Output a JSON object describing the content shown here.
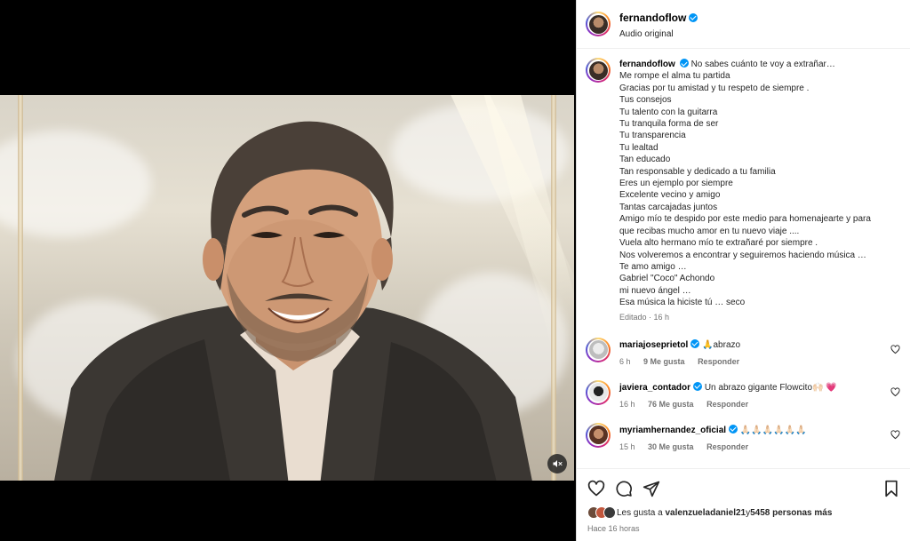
{
  "post": {
    "author": "fernandoflow",
    "audio_label": "Audio original"
  },
  "caption": {
    "author": "fernandoflow",
    "lines": [
      "No sabes cuánto te voy a extrañar…",
      "Me rompe el alma tu partida",
      "Gracias por tu amistad y tu respeto de siempre .",
      "Tus consejos",
      "Tu talento con la guitarra",
      "Tu tranquila forma de ser",
      "Tu transparencia",
      "Tu lealtad",
      "Tan educado",
      "Tan responsable y dedicado a tu familia",
      "Eres un ejemplo por siempre",
      "Excelente vecino y amigo",
      "Tantas carcajadas juntos",
      "Amigo mío te despido por este medio para homenajearte y para",
      "que recibas mucho amor en tu nuevo viaje ....",
      "Vuela alto hermano mío te extrañaré por siempre .",
      "Nos volveremos a encontrar y seguiremos haciendo música …",
      "Te amo amigo …",
      "Gabriel \"Coco\" Achondo",
      "mi nuevo ángel …",
      "Esa música la hiciste tú … seco"
    ],
    "edited": "Editado · 16 h"
  },
  "comments": [
    {
      "user": "mariajoseprietol",
      "text": "🙏abrazo",
      "time": "6 h",
      "likes": "9 Me gusta",
      "reply": "Responder"
    },
    {
      "user": "javiera_contador",
      "text": "Un abrazo gigante Flowcito🙌🏻 💗",
      "time": "16 h",
      "likes": "76 Me gusta",
      "reply": "Responder"
    },
    {
      "user": "myriamhernandez_oficial",
      "text": "🙏🏻🙏🏻🙏🏻🙏🏻🙏🏻🙏🏻",
      "time": "15 h",
      "likes": "30 Me gusta",
      "reply": "Responder"
    }
  ],
  "likes": {
    "prefix": "Les gusta a",
    "user": "valenzueladaniel21",
    "middle": " y ",
    "count": "5458 personas más"
  },
  "timestamp": "Hace 16 horas",
  "colors": {
    "verified": "#0095f6",
    "muted_text": "#737373"
  },
  "icons": [
    "heart-icon",
    "comment-icon",
    "share-icon",
    "save-icon",
    "mute-icon",
    "verified-icon"
  ]
}
